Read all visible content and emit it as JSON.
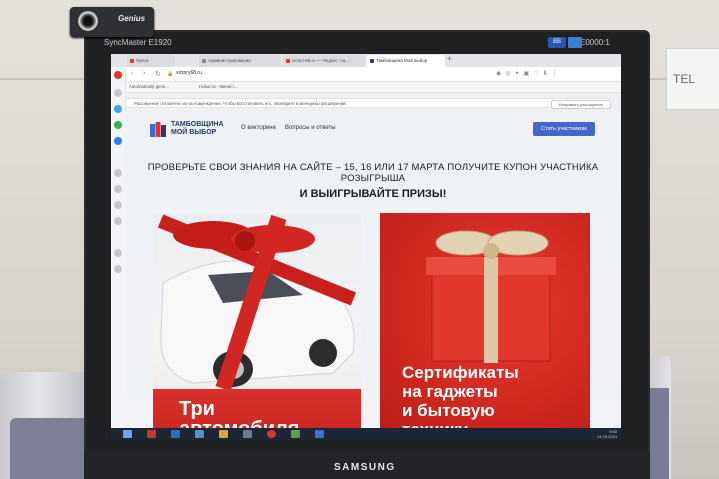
{
  "webcam": {
    "brand": "Genius"
  },
  "monitor": {
    "model": "SyncMaster E1920",
    "model_right": "E0000:1",
    "brand": "SAMSUNG"
  },
  "wall_sign": {
    "text": "TEL"
  },
  "browser": {
    "tabs": [
      {
        "label": "Opera",
        "color": "#e1322d"
      },
      {
        "label": "Администрирование",
        "color": "#888888"
      },
      {
        "label": "victori-68.ru — Яндекс: на...",
        "color": "#e1322d"
      },
      {
        "label": "Тамбовщина Мой выбор",
        "color": "#2c3a6b",
        "active": true
      }
    ],
    "new_tab": "+",
    "url": "victory68.ru",
    "bookmarks": [
      "Automatically gene...",
      "Новости - Минист..."
    ],
    "notification": "Расширение отключено из-за повреждения. Чтобы восстановить его, перейдите в менеджер расширений.",
    "notification_button": "Исправить расширение"
  },
  "site": {
    "logo_line1": "ТАМБОВЩИНА",
    "logo_line2": "МОЙ ВЫБОР",
    "nav": [
      "О викторине",
      "Вопросы и ответы"
    ],
    "cta": "Стать участником",
    "headline": "ПРОВЕРЬТЕ СВОИ ЗНАНИЯ НА САЙТЕ – 15, 16 ИЛИ 17 МАРТА ПОЛУЧИТЕ КУПОН УЧАСТНИКА РОЗЫГРЫША",
    "subhead": "И ВЫИГРЫВАЙТЕ ПРИЗЫ!",
    "cards": [
      {
        "title_line1": "Три",
        "title_line2": "автомобиля"
      },
      {
        "title_line1": "Сертификаты",
        "title_line2": "на гаджеты",
        "title_line3": "и бытовую",
        "title_line4": "технику"
      }
    ]
  },
  "taskbar": {
    "time": "9:50",
    "date": "14.03.2024"
  },
  "colors": {
    "accent": "#4269c7",
    "brand_red": "#d02920",
    "logo_blue": "#2c3a6b"
  }
}
